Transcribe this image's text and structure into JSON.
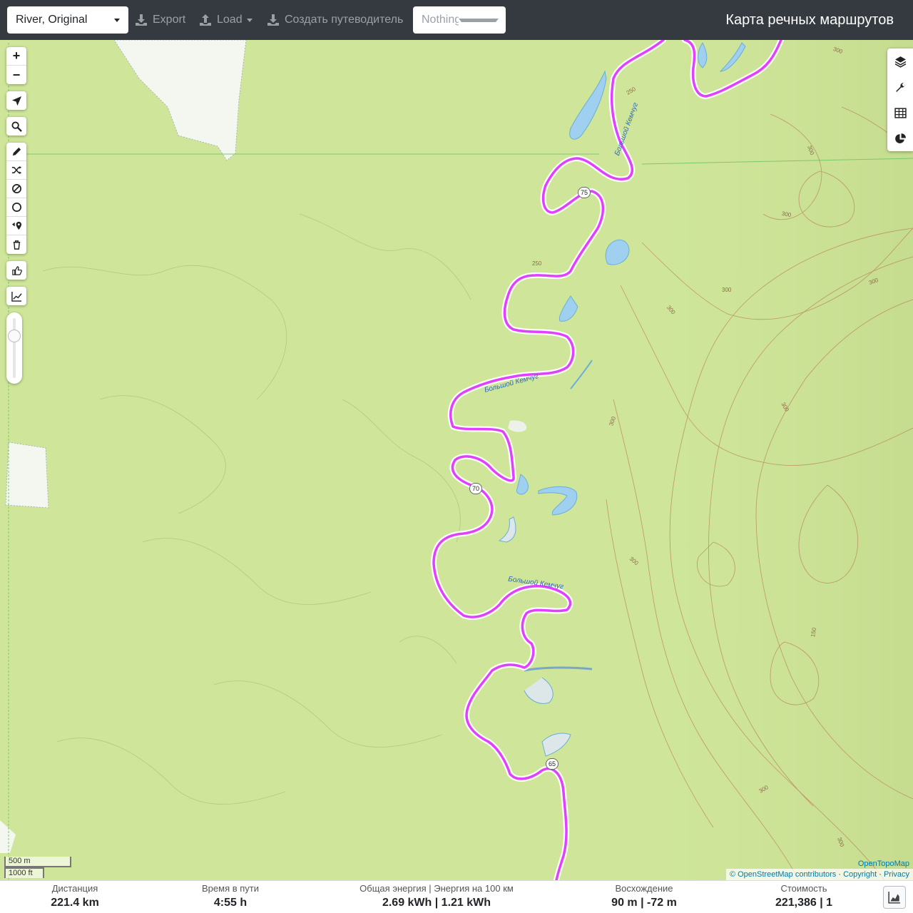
{
  "topbar": {
    "profile": "River, Original",
    "export_label": "Export",
    "load_label": "Load",
    "guide_label": "Создать путеводитель",
    "select_placeholder": "Nothing selected",
    "app_title": "Карта речных маршрутов"
  },
  "map": {
    "zoom_in": "+",
    "zoom_out": "−",
    "river_labels": [
      "Большой Кемчуг",
      "Большой Кемчуг",
      "Большой Кемчуг"
    ],
    "km_markers": [
      "75",
      "70",
      "65"
    ],
    "contour_labels": [
      "250",
      "250",
      "300",
      "300",
      "300",
      "300",
      "300",
      "300",
      "300",
      "300",
      "150",
      "300",
      "300",
      "300"
    ],
    "scale_metric": "500 m",
    "scale_imperial": "1000 ft",
    "attribution_provider": "OpenTopoMap",
    "attribution_osm": "© OpenStreetMap contributors",
    "attribution_copyright": "Copyright",
    "attribution_privacy": "Privacy",
    "sep": " · "
  },
  "footer": {
    "stats": [
      {
        "label": "Дистанция",
        "value": "221.4 km"
      },
      {
        "label": "Время в пути",
        "value": "4:55 h"
      },
      {
        "label": "Общая энергия | Энергия на 100 км",
        "value": "2.69 kWh | 1.21 kWh"
      },
      {
        "label": "Восхождение",
        "value": "90 m | -72 m"
      },
      {
        "label": "Стоимость",
        "value": "221,386 | 1"
      }
    ]
  },
  "colors": {
    "route": "#e040ff",
    "water": "#9fd0f0",
    "land": "#cfe69a",
    "contour": "#b8845a",
    "topbar": "#343a40"
  }
}
